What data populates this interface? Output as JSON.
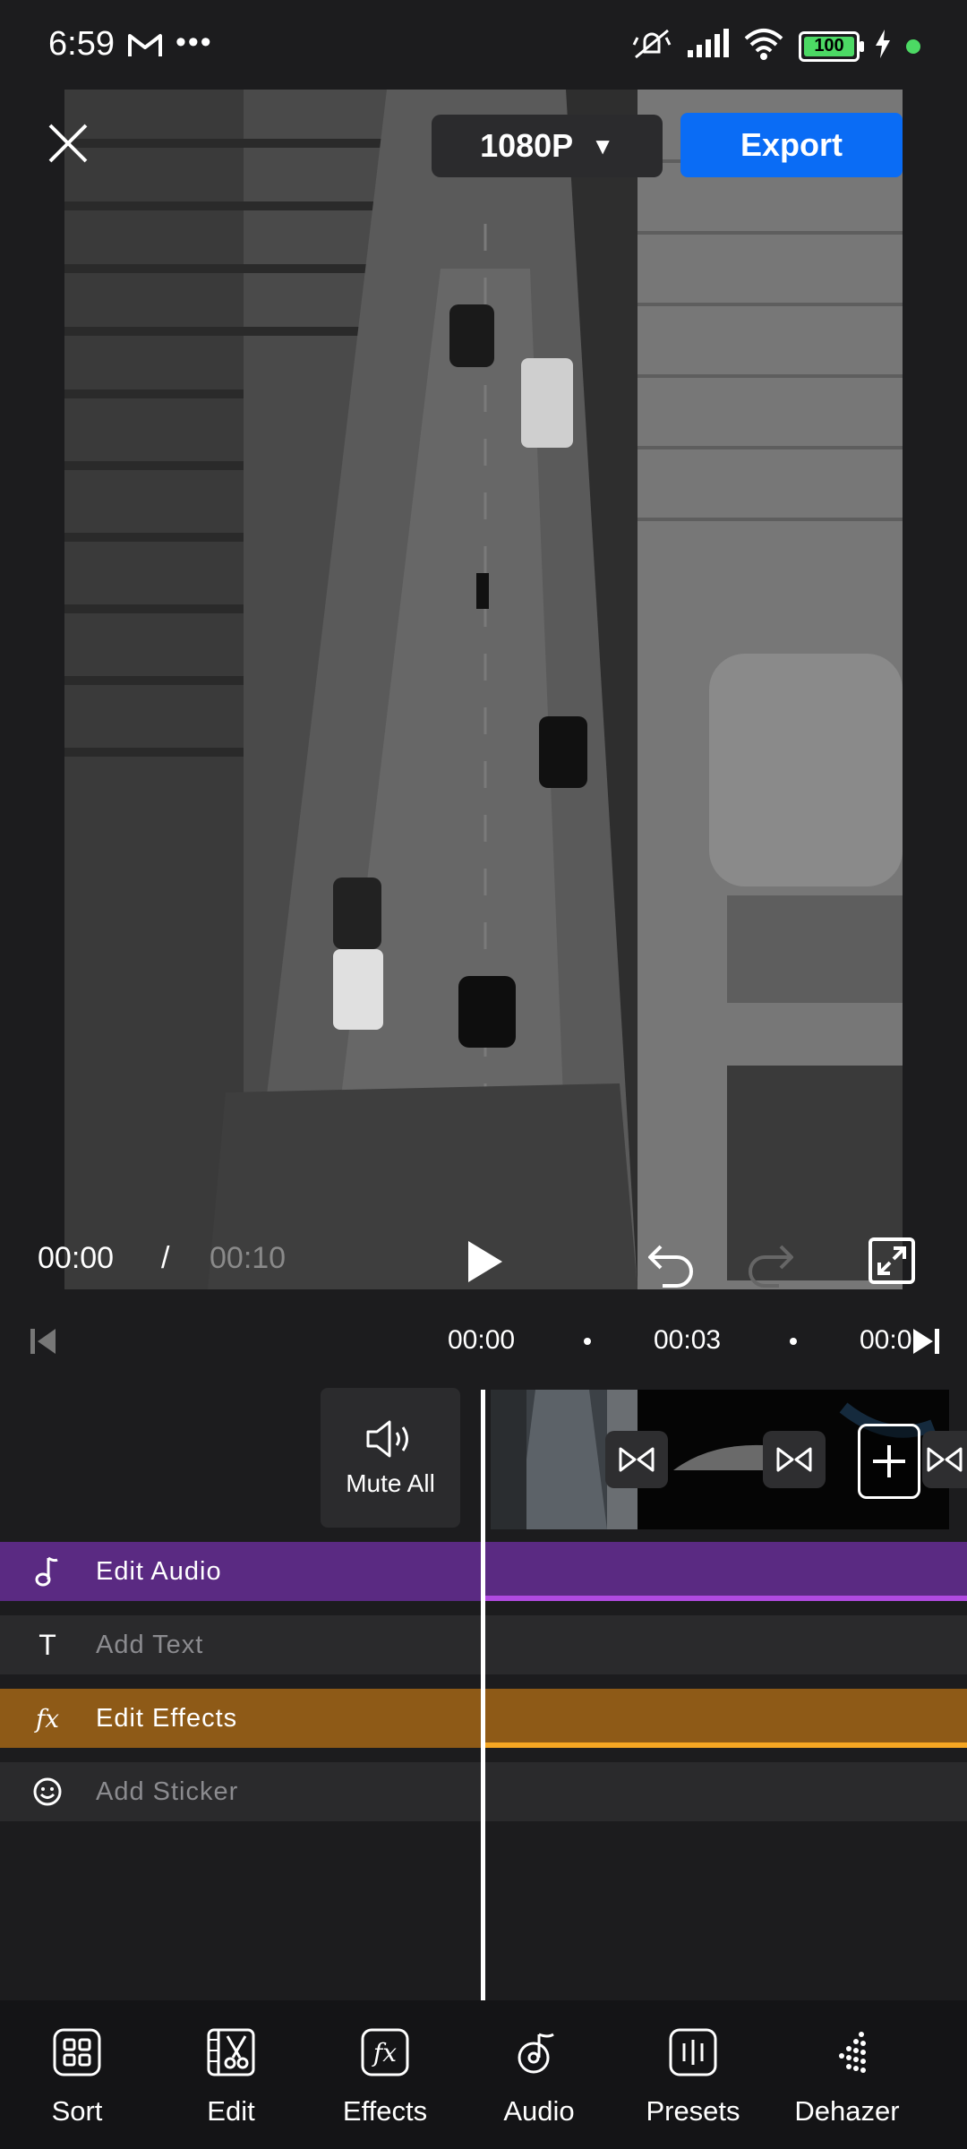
{
  "status_bar": {
    "time": "6:59",
    "more": "•••",
    "battery": "100"
  },
  "top_bar": {
    "resolution": "1080P",
    "resolution_arrow": "▼",
    "export_label": "Export"
  },
  "playback": {
    "current_time": "00:00",
    "separator": "/",
    "total_time": "00:10"
  },
  "ruler": {
    "marks": [
      "00:00",
      "00:03",
      "00:0"
    ]
  },
  "timeline": {
    "mute_all_label": "Mute All",
    "tracks": [
      {
        "label": "Edit Audio",
        "icon": "music-note-icon",
        "color": "#5a2a82"
      },
      {
        "label": "Add Text",
        "icon": "text-icon",
        "color": "#2a2a2c"
      },
      {
        "label": "Edit Effects",
        "icon": "fx-icon",
        "color": "#8e5a17"
      },
      {
        "label": "Add Sticker",
        "icon": "smiley-icon",
        "color": "#2a2a2c"
      }
    ]
  },
  "bottom_nav": {
    "items": [
      {
        "label": "Sort",
        "icon": "sort-grid-icon"
      },
      {
        "label": "Edit",
        "icon": "film-scissors-icon"
      },
      {
        "label": "Effects",
        "icon": "fx-icon"
      },
      {
        "label": "Audio",
        "icon": "music-note-icon"
      },
      {
        "label": "Presets",
        "icon": "presets-icon"
      },
      {
        "label": "Dehazer",
        "icon": "dehazer-icon"
      }
    ]
  },
  "colors": {
    "accent_blue": "#0a6cf5",
    "audio_track": "#5a2a82",
    "effects_track": "#8e5a17",
    "background": "#1c1c1e"
  }
}
